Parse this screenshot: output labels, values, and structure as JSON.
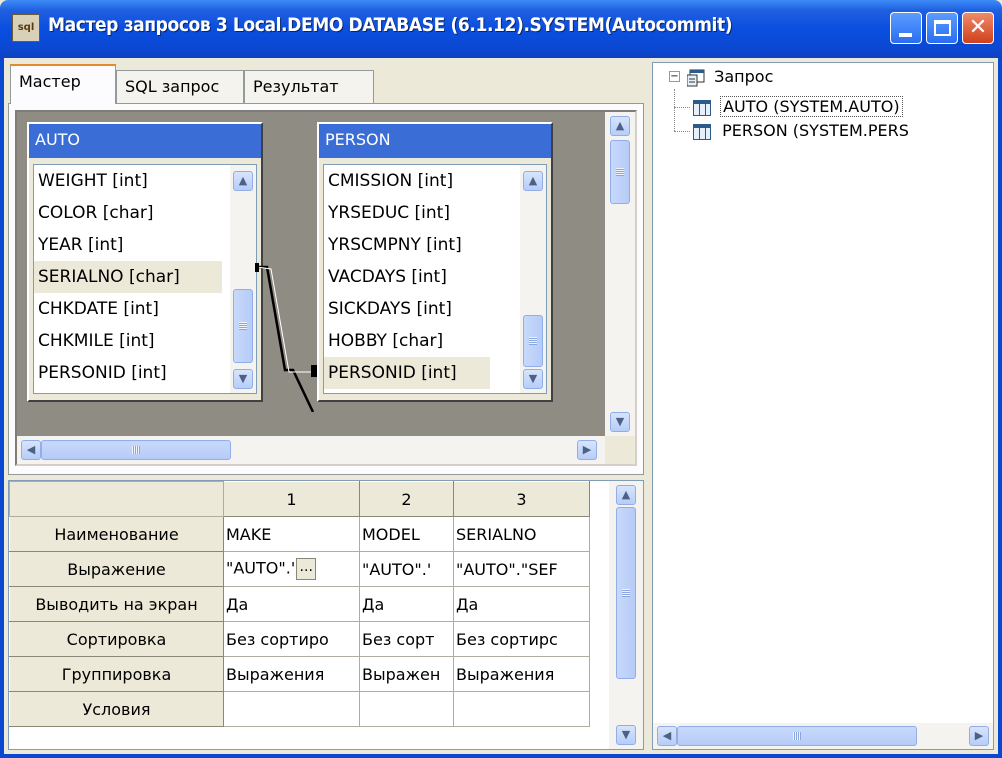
{
  "window": {
    "title": "Мастер запросов 3 Local.DEMO DATABASE (6.1.12).SYSTEM(Autocommit)",
    "app_icon_text": "sql"
  },
  "tabs": [
    {
      "label": "Мастер",
      "active": true
    },
    {
      "label": "SQL запрос",
      "active": false
    },
    {
      "label": "Результат",
      "active": false
    }
  ],
  "design": {
    "tables": [
      {
        "name": "AUTO",
        "fields": [
          "WEIGHT [int]",
          "COLOR [char]",
          "YEAR [int]",
          "SERIALNO [char]",
          "CHKDATE [int]",
          "CHKMILE [int]",
          "PERSONID [int]"
        ],
        "selected_field": "SERIALNO [char]"
      },
      {
        "name": "PERSON",
        "fields": [
          "CMISSION [int]",
          "YRSEDUC [int]",
          "YRSCMPNY [int]",
          "VACDAYS [int]",
          "SICKDAYS [int]",
          "HOBBY [char]",
          "PERSONID [int]"
        ],
        "selected_field": "PERSONID [int]"
      }
    ],
    "join": {
      "from": "AUTO.SERIALNO",
      "to": "PERSON.PERSONID"
    }
  },
  "grid": {
    "columns": [
      "1",
      "2",
      "3"
    ],
    "rows": [
      {
        "label": "Наименование",
        "cells": [
          "MAKE",
          "MODEL",
          "SERIALNO"
        ]
      },
      {
        "label": "Выражение",
        "cells": [
          "\"AUTO\".'",
          "\"AUTO\".'",
          "\"AUTO\".\"SEF"
        ],
        "button": "..."
      },
      {
        "label": "Выводить на экран",
        "cells": [
          "Да",
          "Да",
          "Да"
        ]
      },
      {
        "label": "Сортировка",
        "cells": [
          "Без сортиро",
          "Без сорт",
          "Без сортирс"
        ]
      },
      {
        "label": "Группировка",
        "cells": [
          "Выражения",
          "Выражен",
          "Выражения"
        ]
      },
      {
        "label": "Условия",
        "cells": [
          "",
          "",
          ""
        ]
      }
    ]
  },
  "tree": {
    "root": {
      "label": "Запрос",
      "expander": "−"
    },
    "children": [
      {
        "label": "AUTO (SYSTEM.AUTO)",
        "selected": true
      },
      {
        "label": "PERSON (SYSTEM.PERS"
      }
    ]
  },
  "colors": {
    "titlebar": "#0b48d2",
    "table_header": "#3a6ed6",
    "canvas": "#8f8c84",
    "face": "#ece9d8"
  }
}
